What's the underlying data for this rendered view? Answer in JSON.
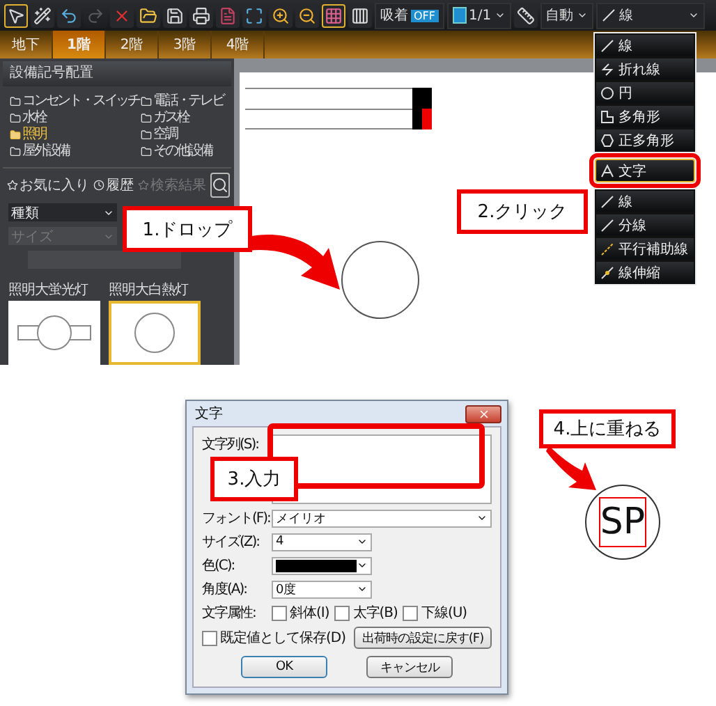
{
  "toolbar": {
    "tools": [
      {
        "kind": "pointer",
        "selected": true,
        "disabled": false
      },
      {
        "kind": "wand",
        "selected": false,
        "disabled": false
      },
      {
        "kind": "undo",
        "selected": false,
        "disabled": false
      },
      {
        "kind": "redo",
        "selected": false,
        "disabled": true
      },
      {
        "kind": "delete",
        "selected": false,
        "disabled": false
      },
      {
        "kind": "open",
        "selected": false,
        "disabled": false
      },
      {
        "kind": "save",
        "selected": false,
        "disabled": false
      },
      {
        "kind": "print",
        "selected": false,
        "disabled": false
      },
      {
        "kind": "export",
        "selected": false,
        "disabled": false
      },
      {
        "kind": "fit",
        "selected": false,
        "disabled": false
      },
      {
        "kind": "zoom-in",
        "selected": false,
        "disabled": false
      },
      {
        "kind": "zoom-out",
        "selected": false,
        "disabled": false
      },
      {
        "kind": "grid",
        "selected": true,
        "disabled": false
      },
      {
        "kind": "columns",
        "selected": false,
        "disabled": false
      }
    ],
    "snap": {
      "label": "吸着",
      "value": "OFF"
    },
    "page": "1/1",
    "scale": "自動",
    "line_type": "線"
  },
  "floor_tabs": [
    {
      "label": "地下",
      "selected": false
    },
    {
      "label": "1階",
      "selected": true
    },
    {
      "label": "2階",
      "selected": false
    },
    {
      "label": "3階",
      "selected": false
    },
    {
      "label": "4階",
      "selected": false
    }
  ],
  "panel": {
    "title": "設備記号配置",
    "categories": [
      {
        "label": "コンセント・スイッチ",
        "selected": false
      },
      {
        "label": "電話・テレビ",
        "selected": false
      },
      {
        "label": "水栓",
        "selected": false
      },
      {
        "label": "ガス栓",
        "selected": false
      },
      {
        "label": "照明",
        "selected": true
      },
      {
        "label": "空調",
        "selected": false
      },
      {
        "label": "屋外設備",
        "selected": false
      },
      {
        "label": "その他設備",
        "selected": false
      }
    ],
    "filters": [
      {
        "label": "お気に入り",
        "disabled": false
      },
      {
        "label": "履歴",
        "disabled": false
      },
      {
        "label": "検索結果",
        "disabled": true
      }
    ],
    "type_select": "種類",
    "size_select": "サイズ",
    "symbols": [
      {
        "label": "照明大蛍光灯",
        "kind": "fluorescent",
        "selected": false
      },
      {
        "label": "照明大白熱灯",
        "kind": "incandescent",
        "selected": true
      }
    ]
  },
  "shape_menu": [
    {
      "label": "線",
      "kind": "line",
      "selected": false
    },
    {
      "label": "折れ線",
      "kind": "polyline",
      "selected": false
    },
    {
      "label": "円",
      "kind": "circle",
      "selected": false
    },
    {
      "label": "多角形",
      "kind": "polygon",
      "selected": false
    },
    {
      "label": "正多角形",
      "kind": "regular-polygon",
      "selected": false
    },
    {
      "label": "文字",
      "kind": "text",
      "selected": true
    },
    {
      "label": "線",
      "kind": "line",
      "selected": false
    },
    {
      "label": "分線",
      "kind": "line",
      "selected": false
    },
    {
      "label": "平行補助線",
      "kind": "aux",
      "selected": false
    },
    {
      "label": "線伸縮",
      "kind": "stretch",
      "selected": false
    }
  ],
  "callouts": [
    "1.ドロップ",
    "2.クリック",
    "3.入力",
    "4.上に重ねる"
  ],
  "dialog": {
    "title": "文字",
    "text_label": "文字列(S):",
    "font_label": "フォント(F):",
    "font": "メイリオ",
    "size_label": "サイズ(Z):",
    "size": "4",
    "color_label": "色(C):",
    "color": "#000000",
    "angle_label": "角度(A):",
    "angle": "0度",
    "attr_label": "文字属性:",
    "attributes": [
      {
        "label": "斜体(I)",
        "checked": false
      },
      {
        "label": "太字(B)",
        "checked": false
      },
      {
        "label": "下線(U)",
        "checked": false
      }
    ],
    "save_default": {
      "label": "既定値として保存(D)",
      "checked": false
    },
    "reset_button": "出荷時の設定に戻す(F)",
    "ok": "OK",
    "cancel": "キャンセル"
  },
  "result_text": "SP"
}
